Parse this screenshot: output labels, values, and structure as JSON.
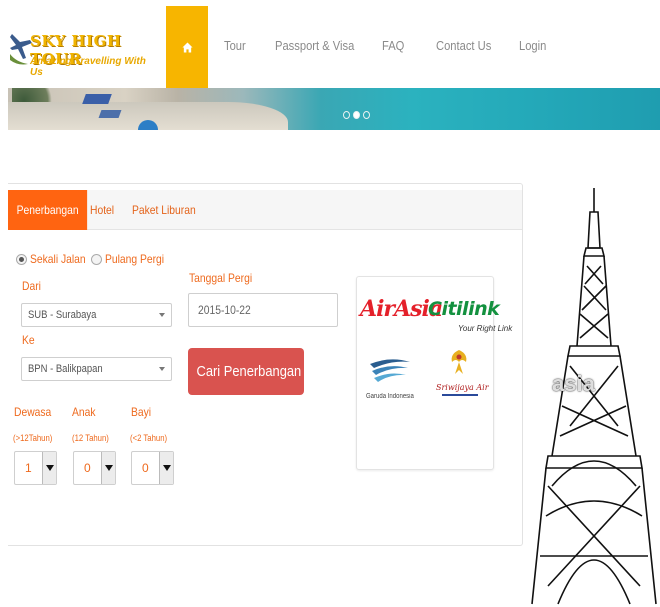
{
  "brand": {
    "title": "SKY HIGH TOUR",
    "tagline": "Amazing Travelling With Us",
    "logo_icon": "airplane-icon"
  },
  "nav": {
    "home_icon": "home-icon",
    "items": [
      "Tour",
      "Passport & Visa",
      "FAQ",
      "Contact Us",
      "Login"
    ]
  },
  "carousel": {
    "slides": 3,
    "active_index": 1
  },
  "search": {
    "tabs": [
      "Penerbangan",
      "Hotel",
      "Paket Liburan"
    ],
    "active_tab": "Penerbangan",
    "trip_type": {
      "options": [
        "Sekali Jalan",
        "Pulang Pergi"
      ],
      "selected": "Sekali Jalan"
    },
    "from": {
      "label": "Dari",
      "value": "SUB - Surabaya"
    },
    "to": {
      "label": "Ke",
      "value": "BPN - Balikpapan"
    },
    "date": {
      "label": "Tanggal Pergi",
      "value": "2015-10-22"
    },
    "submit_label": "Cari Penerbangan",
    "passengers": [
      {
        "label": "Dewasa",
        "note": "(>12Tahun)",
        "value": "1"
      },
      {
        "label": "Anak",
        "note": "(12 Tahun)",
        "value": "0"
      },
      {
        "label": "Bayi",
        "note": "(<2 Tahun)",
        "value": "0"
      }
    ]
  },
  "airlines": {
    "airasia": "AirAsia",
    "citilink": "Citilink",
    "citilink_tag": "Your Right Link",
    "garuda": "Garuda Indonesia",
    "sriwijaya": "Sriwijaya Air"
  },
  "watermark": "asia",
  "colors": {
    "accent_orange": "#ff6411",
    "home_yellow": "#f7b500",
    "button_red": "#d9534f",
    "label_orange": "#ee6a1e"
  }
}
